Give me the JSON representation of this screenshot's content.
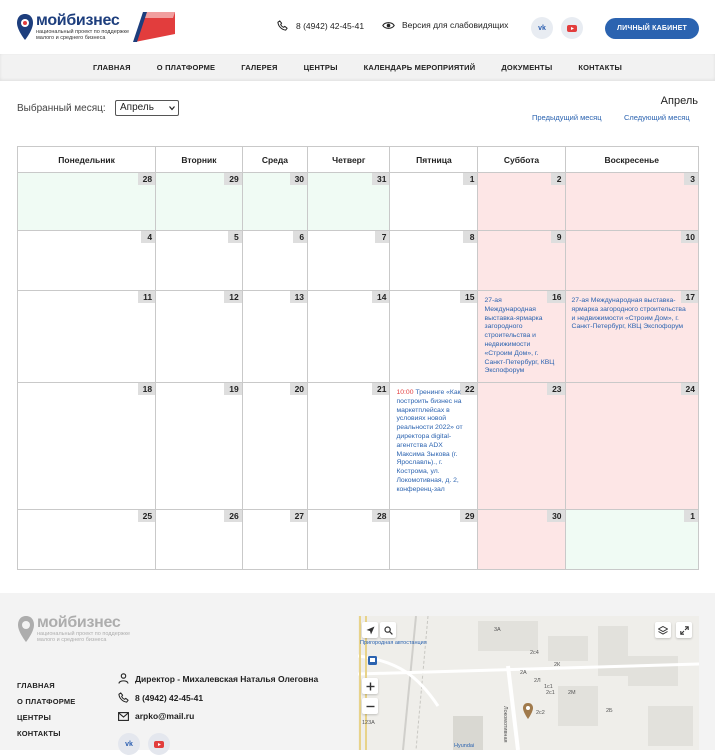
{
  "header": {
    "brand": "мойбизнес",
    "tagline_1": "национальный проект по поддержке",
    "tagline_2": "малого и среднего бизнеса",
    "phone": "8 (4942) 42-45-41",
    "accessibility": "Версия для слабовидящих",
    "vk": "vk",
    "cabinet": "ЛИЧНЫЙ КАБИНЕТ"
  },
  "nav": [
    "ГЛАВНАЯ",
    "О ПЛАТФОРМЕ",
    "ГАЛЕРЕЯ",
    "ЦЕНТРЫ",
    "КАЛЕНДАРЬ МЕРОПРИЯТИЙ",
    "ДОКУМЕНТЫ",
    "КОНТАКТЫ"
  ],
  "controls": {
    "month_label": "Выбранный месяц:",
    "selected_month": "Апрель",
    "current_month": "Апрель",
    "prev": "Предыдущий месяц",
    "next": "Следующий месяц"
  },
  "calendar": {
    "weekdays": [
      "Понедельник",
      "Вторник",
      "Среда",
      "Четверг",
      "Пятница",
      "Суббота",
      "Воскресенье"
    ],
    "weeks": [
      [
        {
          "d": "28",
          "t": "other"
        },
        {
          "d": "29",
          "t": "other"
        },
        {
          "d": "30",
          "t": "other"
        },
        {
          "d": "31",
          "t": "other"
        },
        {
          "d": "1",
          "t": "day"
        },
        {
          "d": "2",
          "t": "weekend"
        },
        {
          "d": "3",
          "t": "weekend"
        }
      ],
      [
        {
          "d": "4",
          "t": "day"
        },
        {
          "d": "5",
          "t": "day"
        },
        {
          "d": "6",
          "t": "day"
        },
        {
          "d": "7",
          "t": "day"
        },
        {
          "d": "8",
          "t": "day"
        },
        {
          "d": "9",
          "t": "weekend"
        },
        {
          "d": "10",
          "t": "weekend"
        }
      ],
      [
        {
          "d": "11",
          "t": "day"
        },
        {
          "d": "12",
          "t": "day"
        },
        {
          "d": "13",
          "t": "day"
        },
        {
          "d": "14",
          "t": "day"
        },
        {
          "d": "15",
          "t": "day"
        },
        {
          "d": "16",
          "t": "weekend",
          "event": "27-ая Международная выставка-ярмарка загородного строительства и недвижимости «Строим Дом», г. Санкт-Петербург, КВЦ Экспофорум"
        },
        {
          "d": "17",
          "t": "weekend",
          "event": "27-ая Международная выставка-ярмарка загородного строительства и недвижимости «Строим Дом», г. Санкт-Петербург, КВЦ Экспофорум"
        }
      ],
      [
        {
          "d": "18",
          "t": "day"
        },
        {
          "d": "19",
          "t": "day"
        },
        {
          "d": "20",
          "t": "day"
        },
        {
          "d": "21",
          "t": "day"
        },
        {
          "d": "22",
          "t": "day",
          "time": "10:00",
          "event": "Тренинге «Как построить бизнес на маркетплейсах в условиях новой реальности 2022» от директора digital-агентства ADX Максима Зыкова (г. Ярославль)., г. Кострома, ул. Локомотивная, д. 2, конференц-зал"
        },
        {
          "d": "23",
          "t": "weekend"
        },
        {
          "d": "24",
          "t": "weekend"
        }
      ],
      [
        {
          "d": "25",
          "t": "day"
        },
        {
          "d": "26",
          "t": "day"
        },
        {
          "d": "27",
          "t": "day"
        },
        {
          "d": "28",
          "t": "day"
        },
        {
          "d": "29",
          "t": "day"
        },
        {
          "d": "30",
          "t": "weekend"
        },
        {
          "d": "1",
          "t": "other"
        }
      ]
    ]
  },
  "footer": {
    "brand": "мойбизнес",
    "tagline_1": "национальный проект по поддержке",
    "tagline_2": "малого и среднего бизнеса",
    "menu": [
      "ГЛАВНАЯ",
      "О ПЛАТФОРМЕ",
      "ЦЕНТРЫ",
      "КОНТАКТЫ"
    ],
    "director": "Директор - Михалевская Наталья Олеговна",
    "phone": "8 (4942) 42-45-41",
    "email": "arpko@mail.ru",
    "vk": "vk",
    "map": {
      "bus_station": "Пригородная автостанция",
      "street": "Локомотивная",
      "labels": [
        "3А",
        "2с4",
        "2К",
        "2с1",
        "2М",
        "2Б",
        "2с2",
        "123А",
        "2А",
        "2Л",
        "1с1"
      ],
      "poi": "Hyundai"
    }
  },
  "colors": {
    "accent": "#2b63b0",
    "weekend": "#fde6e6",
    "other_month": "#f0fbf4",
    "time": "#e23d3d"
  }
}
